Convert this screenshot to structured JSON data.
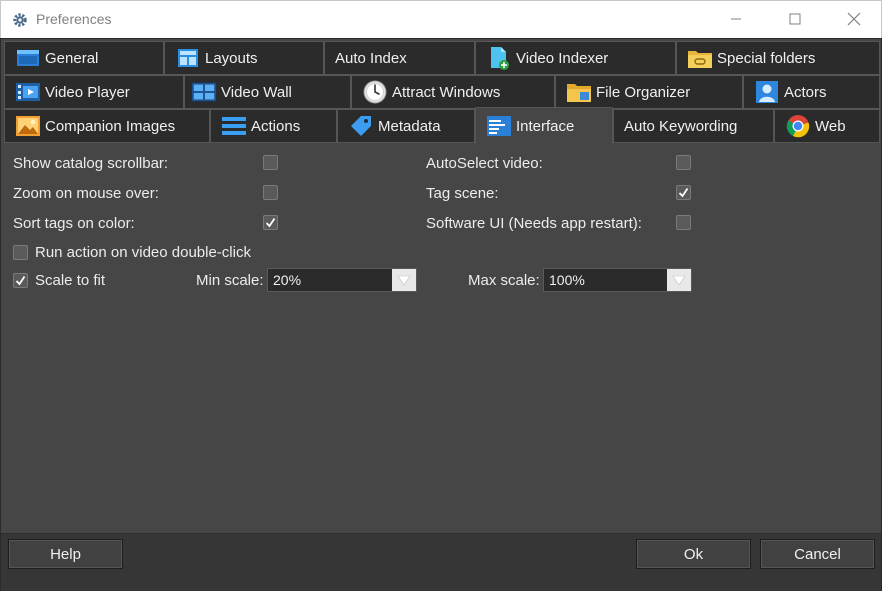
{
  "window": {
    "title": "Preferences"
  },
  "tabs": {
    "row1": [
      {
        "label": "General",
        "icon": "folder-window-icon"
      },
      {
        "label": "Layouts",
        "icon": "layout-icon"
      },
      {
        "label": "Auto Index",
        "icon": ""
      },
      {
        "label": "Video Indexer",
        "icon": "document-add-icon"
      },
      {
        "label": "Special folders",
        "icon": "folder-link-icon"
      }
    ],
    "row2": [
      {
        "label": "Video Player",
        "icon": "film-icon"
      },
      {
        "label": "Video Wall",
        "icon": "video-wall-icon"
      },
      {
        "label": "Attract Windows",
        "icon": "clock-icon"
      },
      {
        "label": "File Organizer",
        "icon": "folder-organize-icon"
      },
      {
        "label": "Actors",
        "icon": "person-icon"
      }
    ],
    "row3": [
      {
        "label": "Companion Images",
        "icon": "image-icon"
      },
      {
        "label": "Actions",
        "icon": "list-icon"
      },
      {
        "label": "Metadata",
        "icon": "tag-icon"
      },
      {
        "label": "Interface",
        "icon": "interface-icon"
      },
      {
        "label": "Auto Keywording",
        "icon": ""
      },
      {
        "label": "Web",
        "icon": "chrome-icon"
      }
    ],
    "active": "Interface"
  },
  "settings": {
    "show_catalog_scrollbar": {
      "label": "Show catalog scrollbar:",
      "checked": false
    },
    "zoom_on_mouse_over": {
      "label": "Zoom on mouse over:",
      "checked": false
    },
    "sort_tags_on_color": {
      "label": "Sort tags on color:",
      "checked": true
    },
    "autoselect_video": {
      "label": "AutoSelect video:",
      "checked": false
    },
    "tag_scene": {
      "label": "Tag scene:",
      "checked": true
    },
    "software_ui": {
      "label": "Software UI (Needs app restart):",
      "checked": false
    },
    "run_action_double_click": {
      "label": "Run action on video double-click",
      "checked": false
    },
    "scale_to_fit": {
      "label": "Scale to fit",
      "checked": true
    },
    "min_scale": {
      "label": "Min scale:",
      "value": "20%"
    },
    "max_scale": {
      "label": "Max scale:",
      "value": "100%"
    }
  },
  "footer": {
    "help": "Help",
    "ok": "Ok",
    "cancel": "Cancel"
  },
  "colors": {
    "window_bg": "#464646",
    "tab_bg": "#2b2b2b",
    "footer_bg": "#363636",
    "text": "#ececec"
  }
}
